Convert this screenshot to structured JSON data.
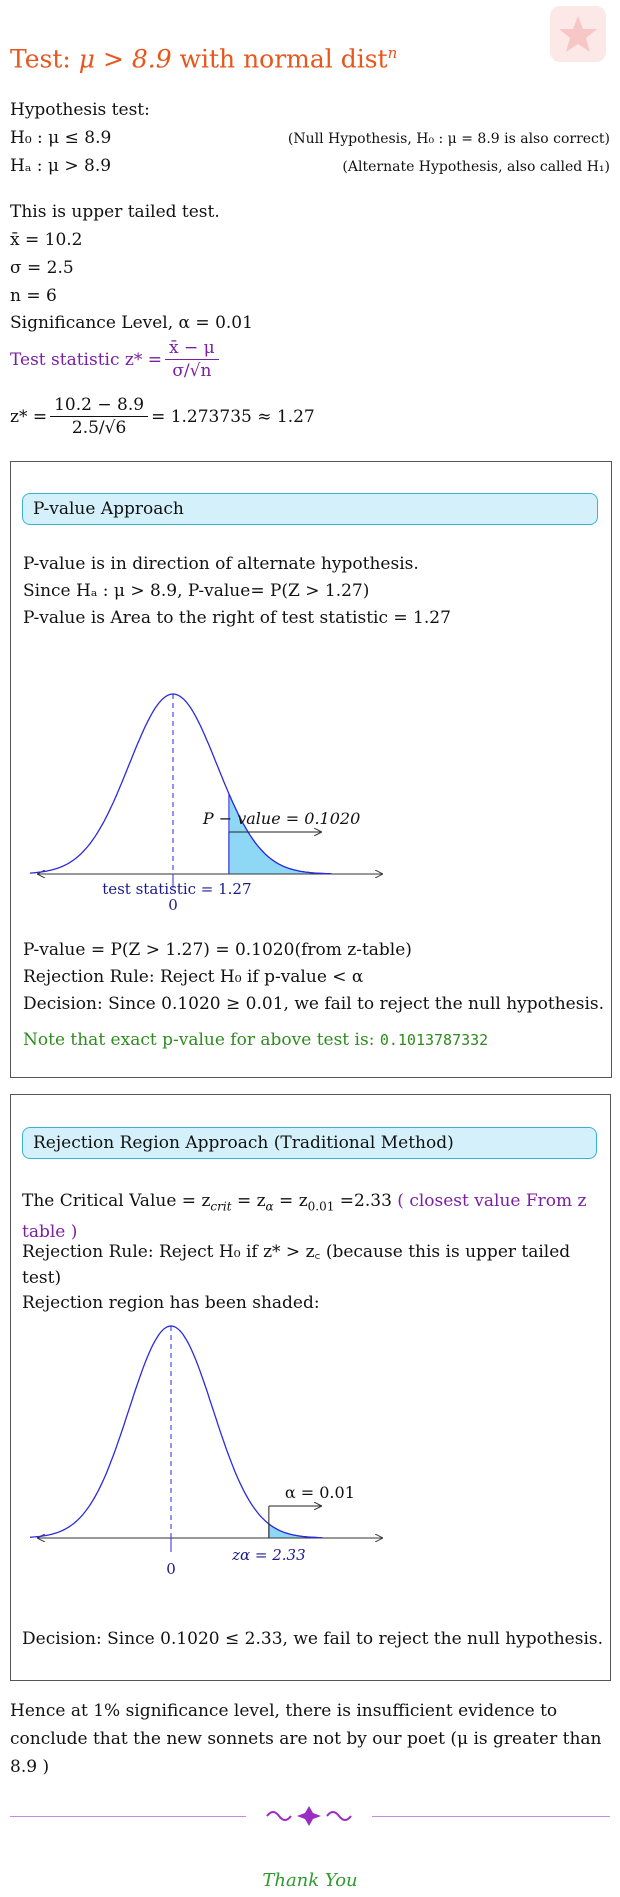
{
  "title": {
    "prefix": "Test: ",
    "math": "μ > 8.9",
    "mid": " with normal dist",
    "sup": "n"
  },
  "hypothesis": {
    "heading": "Hypothesis test:",
    "h0": "H₀ : μ ≤ 8.9",
    "h0_note": "(Null Hypothesis, H₀ : μ = 8.9 is also correct)",
    "ha": "Hₐ : μ > 8.9",
    "ha_note": "(Alternate Hypothesis, also called H₁)"
  },
  "given": {
    "tail": "This is upper tailed test.",
    "xbar": "x̄ = 10.2",
    "sigma": "σ = 2.5",
    "n": "n = 6",
    "alpha": "Significance Level, α = 0.01"
  },
  "test_stat": {
    "label": "Test statistic z* =",
    "formula_num": "x̄ − μ",
    "formula_den": "σ/√n",
    "calc_lhs": "z* =",
    "calc_num": "10.2 − 8.9",
    "calc_den": "2.5/√6",
    "calc_rhs": "= 1.273735 ≈ 1.27"
  },
  "pvalue_section": {
    "header": "P-value Approach",
    "line1": "P-value is in direction of alternate hypothesis.",
    "line2": "Since Hₐ : μ > 8.9, P-value= P(Z > 1.27)",
    "line3": "P-value is Area to the right of test statistic = 1.27",
    "graph_label_p": "P − value = 0.1020",
    "graph_label_ts": "test statistic = 1.27",
    "graph_zero": "0",
    "result": "P-value = P(Z > 1.27) = 0.1020(from z-table)",
    "rule": "Rejection Rule: Reject H₀ if p-value < α",
    "decision": "Decision: Since 0.1020 ≥ 0.01, we fail to reject the null hypothesis.",
    "exact_note": "Note that exact p-value for above test is:",
    "exact_value": "0.1013787332"
  },
  "rr_section": {
    "header": "Rejection Region Approach (Traditional Method)",
    "critical_lead": "The Critical Value = z",
    "critical_mid": "= z",
    "critical_sub1": "crit",
    "critical_sub2": "α",
    "critical_sub3": "0.01",
    "critical_val": " =2.33 ",
    "critical_note": "( closest value From z table )",
    "rule": "Rejection Rule: Reject H₀ if z* > z꜀ (because this is upper tailed test)",
    "shaded": "Rejection region has been shaded:",
    "graph_alpha": "α = 0.01",
    "graph_z": "zα = 2.33",
    "graph_zero": "0",
    "decision": "Decision: Since 0.1020 ≤ 2.33, we fail to reject the null hypothesis."
  },
  "conclusion": "Hence at 1% significance level, there is insufficient evidence to conclude that the new sonnets are not by our poet (μ is greater than 8.9 )",
  "thanks": "Thank You",
  "colors": {
    "title": "#e8561c",
    "curve": "#2b2be0",
    "shade": "#8fd8f5",
    "header_bg": "#d4f1fb",
    "header_border": "#3ab2d8",
    "purple": "#7a1fa2",
    "green": "#2e8b1e"
  }
}
